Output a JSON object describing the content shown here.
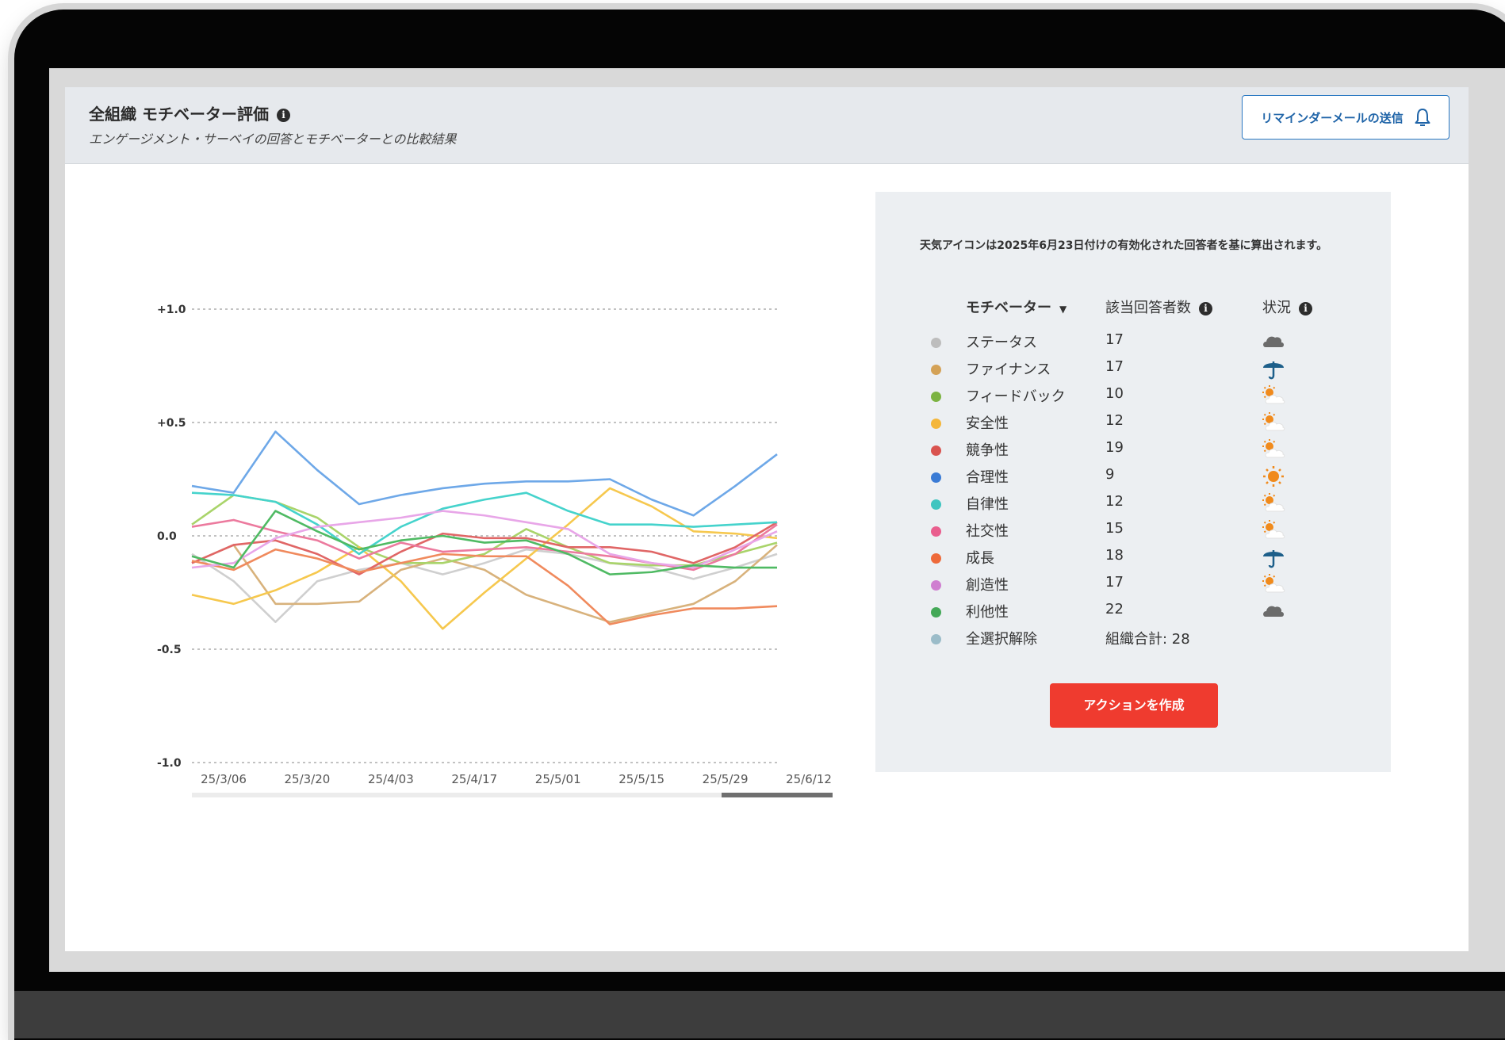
{
  "header": {
    "title": "全組織 モチベーター評価",
    "subtitle": "エンゲージメント・サーベイの回答とモチベーターとの比較結果",
    "reminder_button": "リマインダーメールの送信",
    "bell_icon": "bell-icon",
    "info_icon": "info-icon"
  },
  "panel": {
    "note": "天気アイコンは2025年6月23日付けの有効化された回答者を基に算出されます。",
    "col_motivator": "モチベーター",
    "col_respondents": "該当回答者数",
    "col_status": "状況",
    "rows": [
      {
        "name": "ステータス",
        "count": "17",
        "color": "#bdbdbd",
        "icon": "cloud"
      },
      {
        "name": "ファイナンス",
        "count": "17",
        "color": "#d4a257",
        "icon": "umbrella"
      },
      {
        "name": "フィードバック",
        "count": "10",
        "color": "#7cb342",
        "icon": "sun-cloud"
      },
      {
        "name": "安全性",
        "count": "12",
        "color": "#f4b63a",
        "icon": "sun-cloud"
      },
      {
        "name": "競争性",
        "count": "19",
        "color": "#d9534f",
        "icon": "sun-cloud"
      },
      {
        "name": "合理性",
        "count": "9",
        "color": "#3a7bd5",
        "icon": "sun"
      },
      {
        "name": "自律性",
        "count": "12",
        "color": "#3fc5c0",
        "icon": "sun-cloud"
      },
      {
        "name": "社交性",
        "count": "15",
        "color": "#e95e8e",
        "icon": "sun-cloud"
      },
      {
        "name": "成長",
        "count": "18",
        "color": "#ee6a3a",
        "icon": "umbrella"
      },
      {
        "name": "創造性",
        "count": "17",
        "color": "#cf7fd0",
        "icon": "sun-cloud"
      },
      {
        "name": "利他性",
        "count": "22",
        "color": "#43a857",
        "icon": "cloud"
      },
      {
        "name": "全選択解除",
        "count": "組織合計: 28",
        "color": "#9bbcc9",
        "icon": ""
      }
    ],
    "action_button": "アクションを作成"
  },
  "chart_data": {
    "type": "line",
    "x": [
      "25/3/06",
      "25/3/13",
      "25/3/20",
      "25/3/27",
      "25/4/03",
      "25/4/10",
      "25/4/17",
      "25/4/24",
      "25/5/01",
      "25/5/08",
      "25/5/15",
      "25/5/22",
      "25/5/29",
      "25/6/05",
      "25/6/12"
    ],
    "x_tick_labels": [
      "25/3/06",
      "25/3/20",
      "25/4/03",
      "25/4/17",
      "25/5/01",
      "25/5/15",
      "25/5/29",
      "25/6/12"
    ],
    "ylim": [
      -1.0,
      1.0
    ],
    "y_ticks": [
      "+1.0",
      "+0.5",
      "0.0",
      "-0.5",
      "-1.0"
    ],
    "grid": true,
    "series": [
      {
        "name": "ステータス",
        "color": "#cfcfcf",
        "values": [
          -0.08,
          -0.2,
          -0.38,
          -0.2,
          -0.15,
          -0.12,
          -0.17,
          -0.12,
          -0.06,
          -0.08,
          -0.12,
          -0.14,
          -0.19,
          -0.14,
          -0.08
        ]
      },
      {
        "name": "ファイナンス",
        "color": "#d8b27c",
        "values": [
          -0.12,
          -0.04,
          -0.3,
          -0.3,
          -0.29,
          -0.15,
          -0.1,
          -0.15,
          -0.26,
          -0.32,
          -0.38,
          -0.34,
          -0.3,
          -0.2,
          -0.04
        ]
      },
      {
        "name": "フィードバック",
        "color": "#a9d46a",
        "values": [
          0.05,
          0.18,
          0.15,
          0.08,
          -0.05,
          -0.12,
          -0.12,
          -0.08,
          0.03,
          -0.05,
          -0.12,
          -0.13,
          -0.13,
          -0.08,
          -0.03
        ]
      },
      {
        "name": "安全性",
        "color": "#f6c84e",
        "values": [
          -0.26,
          -0.3,
          -0.24,
          -0.16,
          -0.05,
          -0.2,
          -0.41,
          -0.25,
          -0.1,
          0.05,
          0.21,
          0.13,
          0.02,
          0.01,
          -0.01
        ]
      },
      {
        "name": "競争性",
        "color": "#e06666",
        "values": [
          -0.12,
          -0.04,
          -0.02,
          -0.08,
          -0.17,
          -0.07,
          0.01,
          -0.01,
          -0.01,
          -0.05,
          -0.05,
          -0.07,
          -0.12,
          -0.05,
          0.06
        ]
      },
      {
        "name": "合理性",
        "color": "#6ea8e8",
        "values": [
          0.22,
          0.19,
          0.46,
          0.29,
          0.14,
          0.18,
          0.21,
          0.23,
          0.24,
          0.24,
          0.25,
          0.16,
          0.09,
          0.22,
          0.36
        ]
      },
      {
        "name": "自律性",
        "color": "#45d3cc",
        "values": [
          0.19,
          0.18,
          0.15,
          0.05,
          -0.08,
          0.04,
          0.12,
          0.16,
          0.19,
          0.11,
          0.05,
          0.05,
          0.04,
          0.05,
          0.06
        ]
      },
      {
        "name": "社交性",
        "color": "#ec7a9e",
        "values": [
          0.04,
          0.07,
          0.02,
          -0.02,
          -0.1,
          -0.03,
          -0.07,
          -0.06,
          -0.05,
          -0.07,
          -0.09,
          -0.12,
          -0.15,
          -0.08,
          0.05
        ]
      },
      {
        "name": "成長",
        "color": "#f08a5d",
        "values": [
          -0.11,
          -0.15,
          -0.06,
          -0.1,
          -0.16,
          -0.12,
          -0.08,
          -0.09,
          -0.09,
          -0.22,
          -0.39,
          -0.35,
          -0.32,
          -0.32,
          -0.31
        ]
      },
      {
        "name": "創造性",
        "color": "#e8a6e8",
        "values": [
          -0.14,
          -0.12,
          -0.01,
          0.04,
          0.06,
          0.08,
          0.11,
          0.09,
          0.06,
          0.03,
          -0.08,
          -0.12,
          -0.14,
          -0.06,
          0.02
        ]
      },
      {
        "name": "利他性",
        "color": "#4fba63",
        "values": [
          -0.09,
          -0.14,
          0.11,
          0.02,
          -0.06,
          -0.02,
          0.0,
          -0.03,
          -0.02,
          -0.08,
          -0.17,
          -0.16,
          -0.13,
          -0.14,
          -0.14
        ]
      }
    ]
  }
}
